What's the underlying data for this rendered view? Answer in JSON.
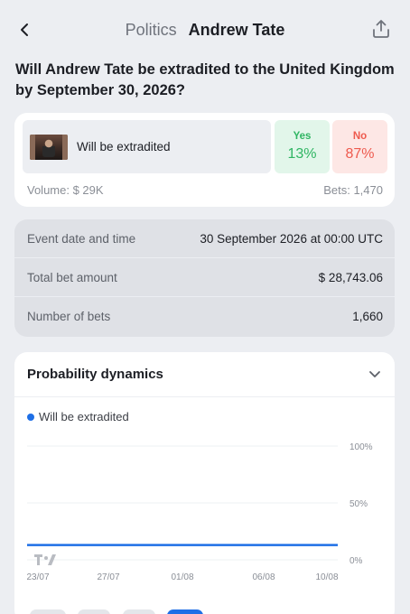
{
  "header": {
    "category": "Politics",
    "title": "Andrew Tate",
    "back_icon": "chevron-left-icon",
    "share_icon": "share-icon"
  },
  "question": "Will Andrew Tate be extradited to the United Kingdom by September 30, 2026?",
  "market": {
    "outcome_label": "Will be extradited",
    "yes": {
      "label": "Yes",
      "percent": "13%"
    },
    "no": {
      "label": "No",
      "percent": "87%"
    },
    "volume": "Volume: $ 29K",
    "bets": "Bets: 1,470"
  },
  "info": [
    {
      "key": "Event date and time",
      "value": "30 September 2026 at 00:00 UTC"
    },
    {
      "key": "Total bet amount",
      "value": "$ 28,743.06"
    },
    {
      "key": "Number of bets",
      "value": "1,660"
    }
  ],
  "probability": {
    "title": "Probability dynamics",
    "expand_icon": "chevron-down-icon"
  },
  "colors": {
    "series": "#1e6fe6",
    "yes": "#2fb562",
    "no": "#ee5a4e"
  },
  "chart_data": {
    "type": "line",
    "title": "Probability dynamics",
    "series": [
      {
        "name": "Will be extradited",
        "x": [
          "23/07",
          "27/07",
          "01/08",
          "06/08",
          "10/08"
        ],
        "values": [
          13,
          13,
          13,
          13,
          13
        ]
      }
    ],
    "x_tick_labels": [
      "23/07",
      "27/07",
      "01/08",
      "06/08",
      "10/08"
    ],
    "y_tick_labels": [
      "100%",
      "50%",
      "0%"
    ],
    "ylim": [
      0,
      100
    ],
    "grid": true,
    "legend": "top-left"
  }
}
